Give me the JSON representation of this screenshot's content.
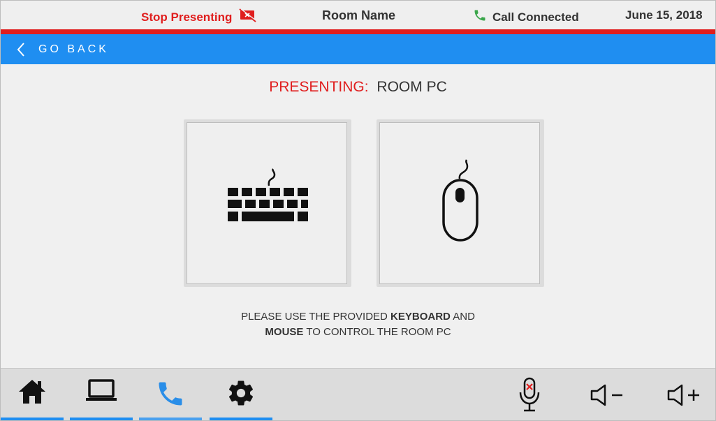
{
  "header": {
    "stop_presenting": "Stop Presenting",
    "room_name": "Room Name",
    "call_status": "Call Connected",
    "date": "June 15, 2018"
  },
  "nav": {
    "go_back": "GO BACK"
  },
  "main": {
    "presenting_label": "PRESENTING:",
    "presenting_source": "ROOM PC",
    "instruction": {
      "part1": "PLEASE USE THE PROVIDED ",
      "keyboard": "KEYBOARD",
      "part2": " AND",
      "mouse": "MOUSE",
      "part3": " TO CONTROL THE ROOM PC"
    },
    "cards": [
      {
        "name": "keyboard",
        "icon": "keyboard-icon"
      },
      {
        "name": "mouse",
        "icon": "mouse-icon"
      }
    ]
  },
  "bottom_nav": {
    "items": [
      {
        "icon": "home-icon"
      },
      {
        "icon": "laptop-icon"
      },
      {
        "icon": "phone-icon",
        "active": true
      },
      {
        "icon": "gear-icon"
      }
    ],
    "controls": [
      {
        "icon": "mic-muted-icon"
      },
      {
        "icon": "volume-down-icon"
      },
      {
        "icon": "volume-up-icon"
      }
    ]
  },
  "colors": {
    "accent": "#1f8ef1",
    "alert": "#e01e1e",
    "call_green": "#3aa64a",
    "active_icon": "#2a8ee8"
  }
}
